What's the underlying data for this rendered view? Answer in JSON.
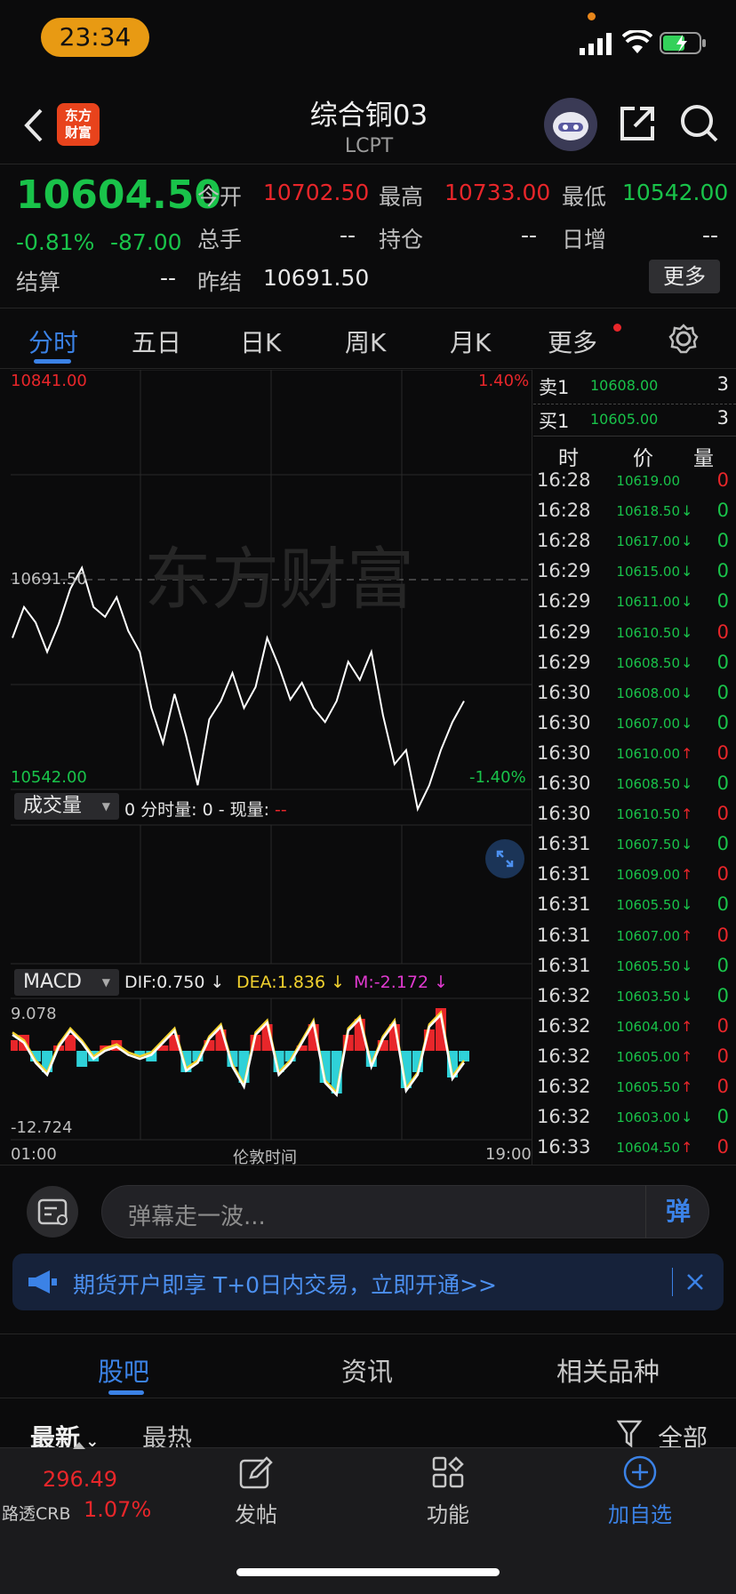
{
  "status_bar": {
    "time": "23:34"
  },
  "header": {
    "title": "综合铜03",
    "subtitle": "LCPT",
    "logo_text": "东方\n财富"
  },
  "quote": {
    "last": "10604.50",
    "change_pct": "-0.81%",
    "change": "-87.00",
    "open_label": "今开",
    "open": "10702.50",
    "high_label": "最高",
    "high": "10733.00",
    "low_label": "最低",
    "low": "10542.00",
    "volume_label": "总手",
    "volume": "--",
    "oi_label": "持仓",
    "oi": "--",
    "daily_inc_label": "日增",
    "daily_inc": "--",
    "settle_label": "结算",
    "settle": "--",
    "prev_settle_label": "昨结",
    "prev_settle": "10691.50",
    "more_button": "更多"
  },
  "tabs": [
    "分时",
    "五日",
    "日K",
    "周K",
    "月K",
    "更多"
  ],
  "chart_data": {
    "type": "line",
    "title": "",
    "ylim": [
      10542.0,
      10841.0
    ],
    "y_top_label": "10841.00",
    "y_bottom_label": "10542.00",
    "y_mid_label": "10691.50",
    "pct_top": "1.40%",
    "pct_bottom": "-1.40%",
    "x_start": "01:00",
    "x_end": "19:00",
    "x_center_label": "伦敦时间",
    "watermark": "东方财富",
    "series": [
      {
        "values": [
          10650,
          10672,
          10661,
          10640,
          10660,
          10685,
          10700,
          10672,
          10665,
          10679,
          10655,
          10640,
          10600,
          10575,
          10610,
          10580,
          10545,
          10592,
          10605,
          10625,
          10600,
          10615,
          10650,
          10630,
          10606,
          10618,
          10600,
          10590,
          10605,
          10633,
          10620,
          10640,
          10595,
          10560,
          10570,
          10528,
          10545,
          10570,
          10590,
          10605
        ]
      }
    ],
    "volume_panel": {
      "selector": "成交量",
      "fenshi_label": "0 分时量: 0 - 现量:",
      "xianliang": "--"
    },
    "macd_panel": {
      "selector": "MACD",
      "dif": "DIF:0.750 ↓",
      "dea": "DEA:1.836 ↓",
      "m": "M:-2.172 ↓",
      "top": "9.078",
      "bottom": "-12.724",
      "hist": [
        2,
        3,
        -2,
        -4,
        1,
        3,
        -3,
        -2,
        1,
        2,
        0,
        -1,
        -2,
        1,
        3,
        -4,
        -2,
        2,
        4,
        -3,
        -6,
        3,
        5,
        -4,
        -2,
        1,
        5,
        -6,
        -8,
        3,
        6,
        -3,
        2,
        5,
        -7,
        -4,
        4,
        8,
        -5,
        -2
      ],
      "dif_line": [
        4,
        2,
        -3,
        -6,
        1,
        5,
        2,
        -2,
        0,
        1,
        -1,
        -2,
        -1,
        2,
        5,
        -5,
        -3,
        3,
        6,
        -4,
        -9,
        4,
        7,
        -6,
        -3,
        2,
        7,
        -8,
        -11,
        5,
        8,
        -4,
        3,
        7,
        -10,
        -6,
        6,
        9,
        -7,
        -3
      ]
    }
  },
  "order_book": {
    "ask_label": "卖1",
    "ask_price": "10608.00",
    "ask_vol": "3",
    "bid_label": "买1",
    "bid_price": "10605.00",
    "bid_vol": "3"
  },
  "ticks_header": {
    "time": "时",
    "price": "价",
    "vol": "量"
  },
  "ticks": [
    {
      "t": "16:28",
      "p": "10619.00",
      "a": "",
      "v": "0",
      "vc": "red"
    },
    {
      "t": "16:28",
      "p": "10618.50",
      "a": "↓",
      "v": "0",
      "vc": "green"
    },
    {
      "t": "16:28",
      "p": "10617.00",
      "a": "↓",
      "v": "0",
      "vc": "green"
    },
    {
      "t": "16:29",
      "p": "10615.00",
      "a": "↓",
      "v": "0",
      "vc": "green"
    },
    {
      "t": "16:29",
      "p": "10611.00",
      "a": "↓",
      "v": "0",
      "vc": "green"
    },
    {
      "t": "16:29",
      "p": "10610.50",
      "a": "↓",
      "v": "0",
      "vc": "red"
    },
    {
      "t": "16:29",
      "p": "10608.50",
      "a": "↓",
      "v": "0",
      "vc": "green"
    },
    {
      "t": "16:30",
      "p": "10608.00",
      "a": "↓",
      "v": "0",
      "vc": "green"
    },
    {
      "t": "16:30",
      "p": "10607.00",
      "a": "↓",
      "v": "0",
      "vc": "green"
    },
    {
      "t": "16:30",
      "p": "10610.00",
      "a": "↑",
      "v": "0",
      "vc": "red"
    },
    {
      "t": "16:30",
      "p": "10608.50",
      "a": "↓",
      "v": "0",
      "vc": "green"
    },
    {
      "t": "16:30",
      "p": "10610.50",
      "a": "↑",
      "v": "0",
      "vc": "red"
    },
    {
      "t": "16:31",
      "p": "10607.50",
      "a": "↓",
      "v": "0",
      "vc": "green"
    },
    {
      "t": "16:31",
      "p": "10609.00",
      "a": "↑",
      "v": "0",
      "vc": "red"
    },
    {
      "t": "16:31",
      "p": "10605.50",
      "a": "↓",
      "v": "0",
      "vc": "green"
    },
    {
      "t": "16:31",
      "p": "10607.00",
      "a": "↑",
      "v": "0",
      "vc": "red"
    },
    {
      "t": "16:31",
      "p": "10605.50",
      "a": "↓",
      "v": "0",
      "vc": "green"
    },
    {
      "t": "16:32",
      "p": "10603.50",
      "a": "↓",
      "v": "0",
      "vc": "green"
    },
    {
      "t": "16:32",
      "p": "10604.00",
      "a": "↑",
      "v": "0",
      "vc": "red"
    },
    {
      "t": "16:32",
      "p": "10605.00",
      "a": "↑",
      "v": "0",
      "vc": "red"
    },
    {
      "t": "16:32",
      "p": "10605.50",
      "a": "↑",
      "v": "0",
      "vc": "red"
    },
    {
      "t": "16:32",
      "p": "10603.00",
      "a": "↓",
      "v": "0",
      "vc": "green"
    },
    {
      "t": "16:33",
      "p": "10604.50",
      "a": "↑",
      "v": "0",
      "vc": "red"
    }
  ],
  "danmu": {
    "placeholder": "弹幕走一波...",
    "button": "弹"
  },
  "promo": {
    "text": "期货开户即享 T+0日内交易，立即开通>>"
  },
  "section_tabs": [
    "股吧",
    "资讯",
    "相关品种"
  ],
  "filters": {
    "latest": "最新",
    "hot": "最热",
    "all": "全部"
  },
  "bottom_nav": {
    "index_value": "296.49",
    "index_name": "路透CRB",
    "index_pct": "1.07%",
    "post": "发帖",
    "func": "功能",
    "add": "加自选"
  }
}
